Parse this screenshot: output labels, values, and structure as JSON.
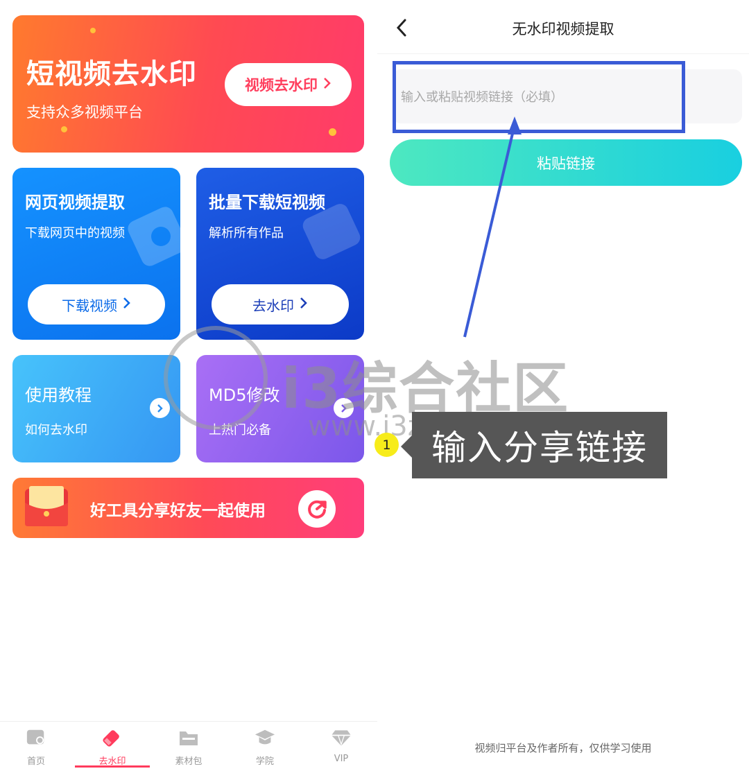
{
  "left": {
    "hero": {
      "title": "短视频去水印",
      "subtitle": "支持众多视频平台",
      "button": "视频去水印",
      "chevron": "›"
    },
    "web_card": {
      "title": "网页视频提取",
      "subtitle": "下载网页中的视频",
      "button": "下载视频"
    },
    "batch_card": {
      "title": "批量下载短视频",
      "subtitle": "解析所有作品",
      "button": "去水印"
    },
    "tutorial_card": {
      "title": "使用教程",
      "subtitle": "如何去水印"
    },
    "md5_card": {
      "title": "MD5修改",
      "subtitle": "上热门必备"
    },
    "share_banner": {
      "text": "好工具分享好友一起使用"
    },
    "tabs": [
      {
        "label": "首页",
        "icon": "home-icon"
      },
      {
        "label": "去水印",
        "icon": "eraser-icon",
        "active": true
      },
      {
        "label": "素材包",
        "icon": "folder-icon"
      },
      {
        "label": "学院",
        "icon": "graduation-cap-icon"
      },
      {
        "label": "VIP",
        "icon": "diamond-icon"
      }
    ]
  },
  "right": {
    "title": "无水印视频提取",
    "url_input": {
      "placeholder": "输入或粘贴视频链接（必填）",
      "value": ""
    },
    "paste_button": "粘贴链接",
    "footer": "视频归平台及作者所有，仅供学习使用"
  },
  "annotation": {
    "step": "1",
    "callout": "输入分享链接",
    "highlight_color": "#3a5bd6"
  },
  "watermark": {
    "text": "i3综合社区",
    "url": "www.i3zh.com"
  },
  "colors": {
    "accent_red": "#ff3b5c",
    "hero_start": "#ff7a2e",
    "paste_button_start": "#4de8c0",
    "paste_button_end": "#19cfe0"
  }
}
